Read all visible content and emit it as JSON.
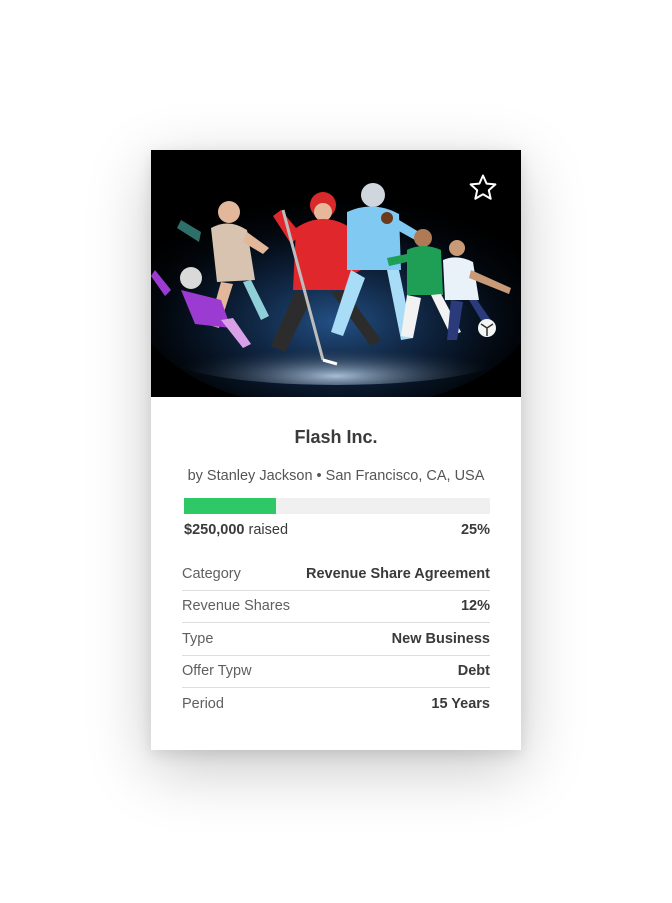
{
  "card": {
    "title": "Flash Inc.",
    "byline": "by Stanley Jackson • San Francisco, CA, USA",
    "favorite_icon": "star-outline-icon",
    "hero_image": "multi-sport athletes collage"
  },
  "funding": {
    "amount": "$250,000",
    "raised_label": "raised",
    "percent_label": "25%",
    "progress_fraction": 0.3,
    "accent_color": "#2ec866"
  },
  "details": [
    {
      "label": "Category",
      "value": "Revenue Share Agreement"
    },
    {
      "label": "Revenue Shares",
      "value": "12%"
    },
    {
      "label": "Type",
      "value": "New Business"
    },
    {
      "label": "Offer Typw",
      "value": "Debt"
    },
    {
      "label": "Period",
      "value": "15 Years"
    }
  ]
}
